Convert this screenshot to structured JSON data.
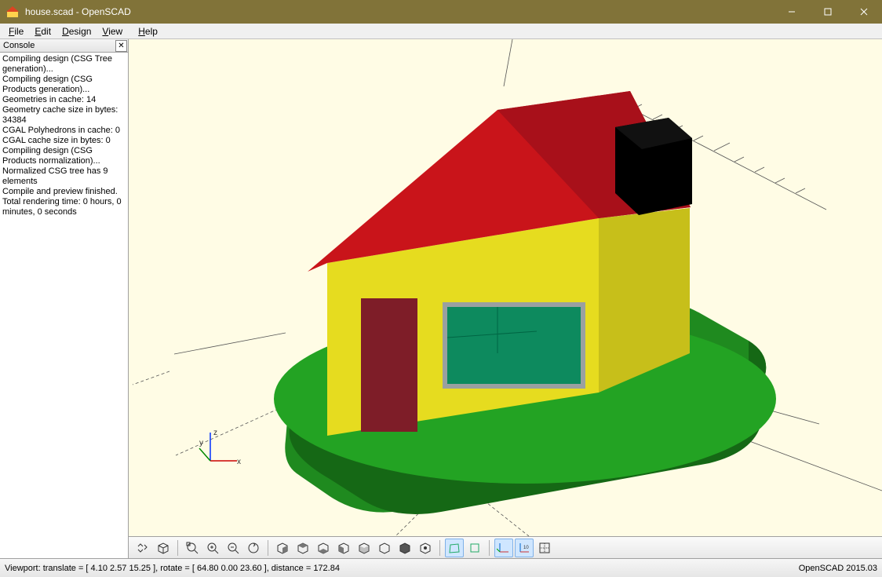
{
  "title": "house.scad - OpenSCAD",
  "menus": {
    "file": "File",
    "edit": "Edit",
    "design": "Design",
    "view": "View",
    "help": "Help"
  },
  "console": {
    "title": "Console",
    "lines": [
      "Compiling design (CSG Tree generation)...",
      "Compiling design (CSG Products generation)...",
      "Geometries in cache: 14",
      "Geometry cache size in bytes: 34384",
      "CGAL Polyhedrons in cache: 0",
      "CGAL cache size in bytes: 0",
      "Compiling design (CSG Products normalization)...",
      "Normalized CSG tree has 9 elements",
      "Compile and preview finished.",
      "Total rendering time: 0 hours, 0 minutes, 0 seconds"
    ]
  },
  "axes": {
    "x": "x",
    "y": "y",
    "z": "z"
  },
  "status": {
    "left": "Viewport: translate = [ 4.10 2.57 15.25 ], rotate = [ 64.80 0.00 23.60 ], distance = 172.84",
    "right": "OpenSCAD 2015.03"
  },
  "toolbar": {
    "preview": "preview",
    "render": "render",
    "zoom_in": "zoom-in",
    "zoom_out": "zoom-out",
    "reset_view": "reset-view",
    "right": "right",
    "top": "top",
    "bottom": "bottom",
    "left": "left",
    "front": "front",
    "back": "back",
    "diagonal": "diagonal",
    "center": "center",
    "perspective": "perspective",
    "orthogonal": "orthogonal",
    "show_axes": "show-axes",
    "show_scale": "show-scale",
    "crosshairs": "crosshairs"
  }
}
